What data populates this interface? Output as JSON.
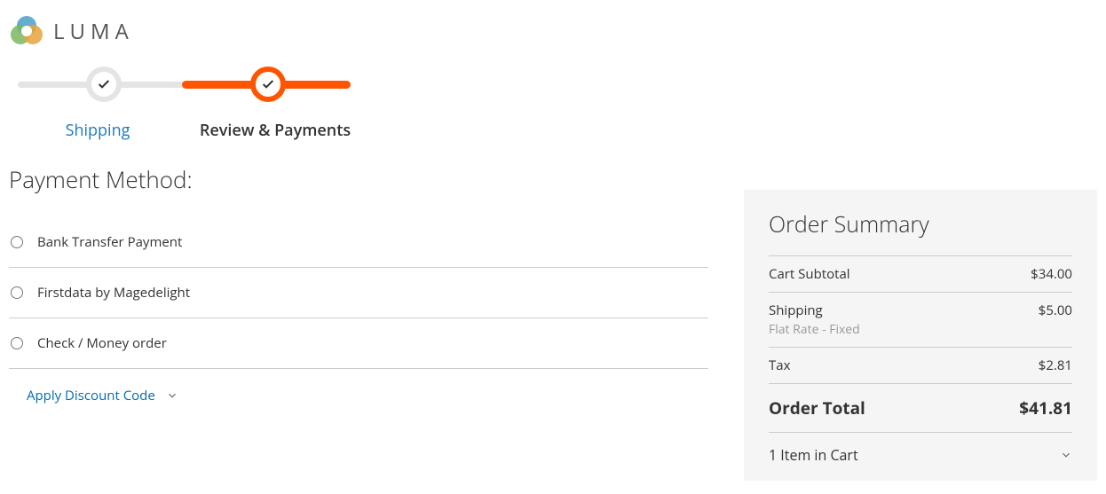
{
  "brand": {
    "name": "LUMA"
  },
  "progress": {
    "steps": [
      {
        "label": "Shipping",
        "state": "done"
      },
      {
        "label": "Review & Payments",
        "state": "current"
      }
    ]
  },
  "payment": {
    "title": "Payment Method:",
    "methods": [
      {
        "label": "Bank Transfer Payment"
      },
      {
        "label": "Firstdata by Magedelight"
      },
      {
        "label": "Check / Money order"
      }
    ],
    "discount_link": "Apply Discount Code"
  },
  "summary": {
    "title": "Order Summary",
    "lines": [
      {
        "label": "Cart Subtotal",
        "value": "$34.00"
      },
      {
        "label": "Shipping",
        "sub": "Flat Rate - Fixed",
        "value": "$5.00"
      },
      {
        "label": "Tax",
        "value": "$2.81"
      }
    ],
    "total": {
      "label": "Order Total",
      "value": "$41.81"
    },
    "cart": {
      "label": "1 Item in Cart"
    }
  }
}
